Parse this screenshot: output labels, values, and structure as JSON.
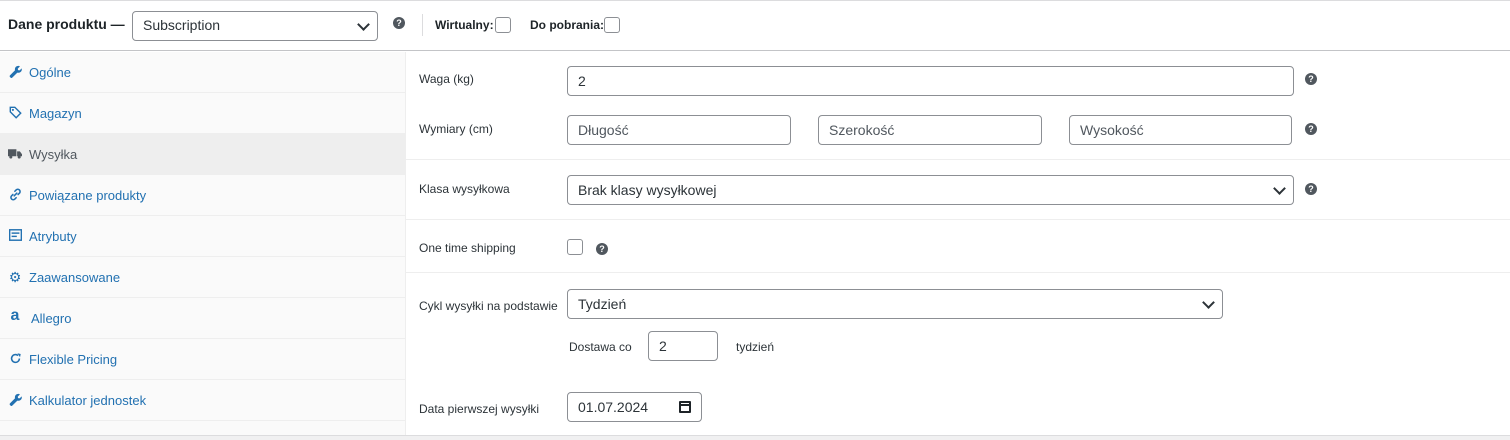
{
  "header": {
    "title": "Dane produktu —",
    "product_type": "Subscription",
    "help": "?",
    "virtual_label": "Wirtualny:",
    "download_label": "Do pobrania:"
  },
  "sidebar": {
    "items": [
      {
        "label": "Ogólne",
        "icon": "wrench-icon",
        "glyph": "🔧",
        "active": false
      },
      {
        "label": "Magazyn",
        "icon": "tag-icon",
        "glyph": "◈",
        "active": false
      },
      {
        "label": "Wysyłka",
        "icon": "truck-icon",
        "glyph": "▬",
        "active": true
      },
      {
        "label": "Powiązane produkty",
        "icon": "link-icon",
        "glyph": "⛓",
        "active": false
      },
      {
        "label": "Atrybuty",
        "icon": "list-icon",
        "glyph": "▤",
        "active": false
      },
      {
        "label": "Zaawansowane",
        "icon": "gear-icon",
        "glyph": "⚙",
        "active": false
      },
      {
        "label": "Allegro",
        "icon": "allegro-icon",
        "glyph": "a",
        "active": false
      },
      {
        "label": "Flexible Pricing",
        "icon": "refresh-icon",
        "glyph": "⟳",
        "active": false
      },
      {
        "label": "Kalkulator jednostek",
        "icon": "wrench-icon",
        "glyph": "🔧",
        "active": false
      }
    ]
  },
  "shipping": {
    "weight_label": "Waga (kg)",
    "weight_value": "2",
    "dimensions_label": "Wymiary (cm)",
    "length_placeholder": "Długość",
    "width_placeholder": "Szerokość",
    "height_placeholder": "Wysokość",
    "class_label": "Klasa wysyłkowa",
    "class_value": "Brak klasy wysyłkowej",
    "one_time_label": "One time shipping",
    "cycle_label": "Cykl wysyłki na podstawie",
    "cycle_value": "Tydzień",
    "delivery_label": "Dostawa co",
    "delivery_value": "2",
    "delivery_unit": "tydzień",
    "first_date_label": "Data pierwszej wysyłki",
    "first_date_value": "01.07.2024"
  }
}
